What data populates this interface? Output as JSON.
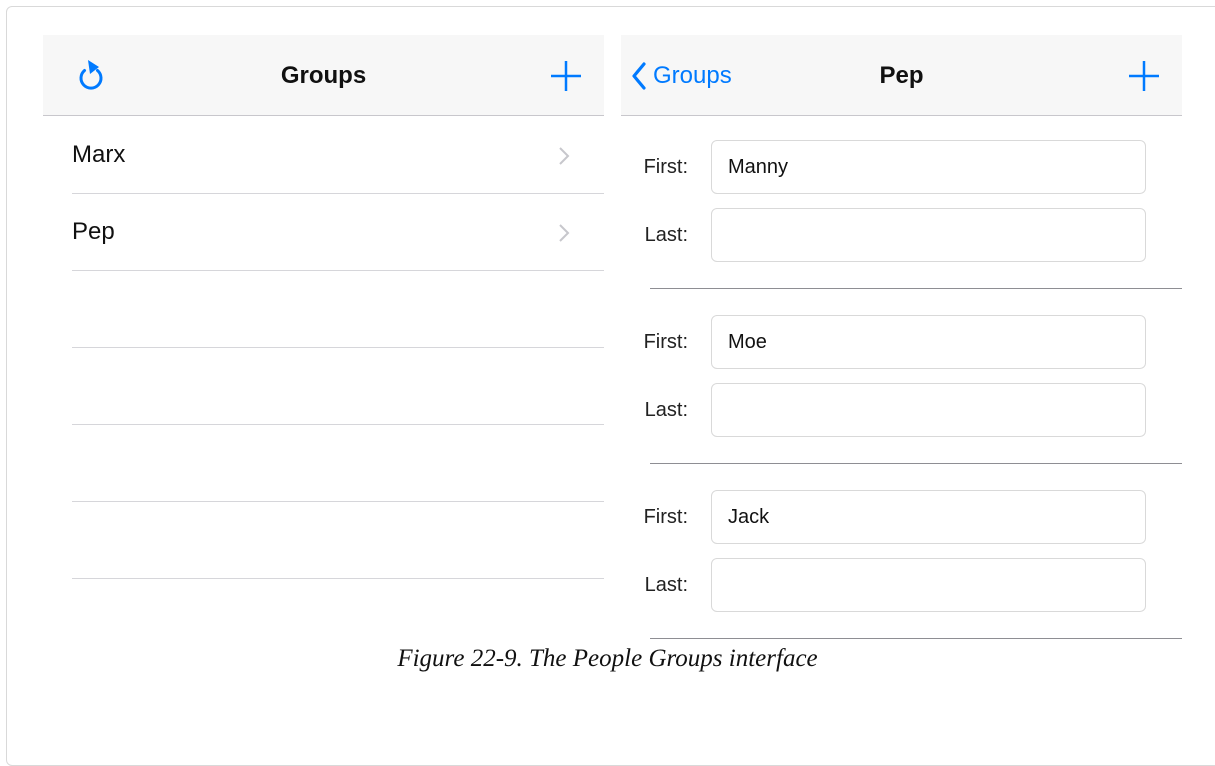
{
  "left_screen": {
    "title": "Groups",
    "refresh_icon": "refresh-icon",
    "add_icon": "plus-icon",
    "rows": [
      {
        "label": "Marx"
      },
      {
        "label": "Pep"
      }
    ]
  },
  "right_screen": {
    "back_label": "Groups",
    "title": "Pep",
    "add_icon": "plus-icon",
    "people": [
      {
        "first_label": "First:",
        "first_value": "Manny",
        "last_label": "Last:",
        "last_value": ""
      },
      {
        "first_label": "First:",
        "first_value": "Moe",
        "last_label": "Last:",
        "last_value": ""
      },
      {
        "first_label": "First:",
        "first_value": "Jack",
        "last_label": "Last:",
        "last_value": ""
      }
    ]
  },
  "caption": "Figure 22-9. The People Groups interface",
  "colors": {
    "accent": "#007aff",
    "navbar_bg": "#f7f7f7",
    "separator": "#d6d6da"
  }
}
